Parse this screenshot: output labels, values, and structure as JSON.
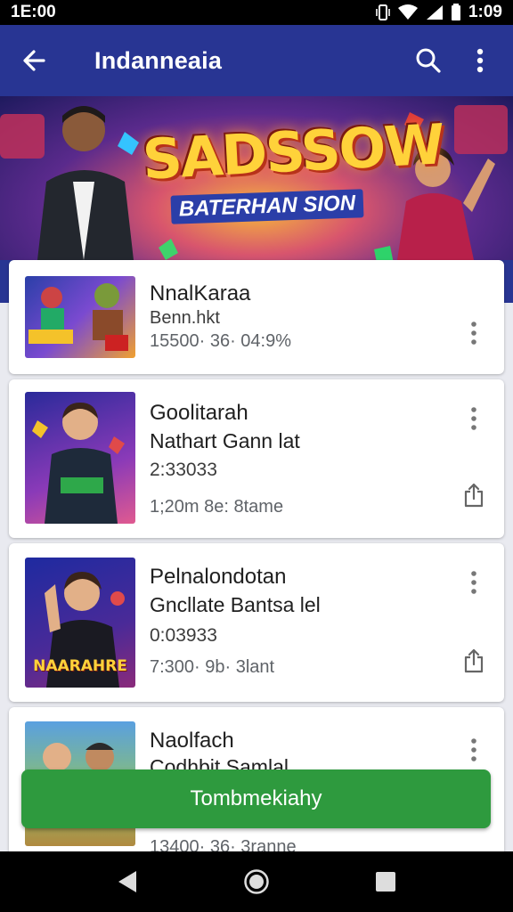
{
  "status": {
    "time_left": "1E:00",
    "time_right": "1:09"
  },
  "app": {
    "title": "Indanneaia"
  },
  "banner": {
    "title": "SADSSOW",
    "subtitle": "BATERHAN SION"
  },
  "items": [
    {
      "title": "NnalKaraa",
      "subtitle": "Benn.hkt",
      "meta": "15500· 36· 04:9%",
      "thumb_text": ""
    },
    {
      "title": "Goolitarah",
      "subtitle": "Nathart Gann lat",
      "extra": "2:33033",
      "meta": "1;20m 8e: 8tame",
      "thumb_text": ""
    },
    {
      "title": "Pelnalondotan",
      "subtitle": "Gncllate Bantsa lel",
      "extra": "0:03933",
      "meta": "7:300· 9b· 3lant",
      "thumb_text": "NAARAHRE"
    },
    {
      "title": "Naolfach",
      "subtitle": "Codhbit Samlal",
      "meta": "13400· 36· 3ranne",
      "thumb_text": ""
    }
  ],
  "install_button": {
    "label": "Tombmekiahy"
  },
  "colors": {
    "app_bar": "#283593",
    "install": "#2e9a3e"
  },
  "icons": [
    "arrow-back-icon",
    "search-icon",
    "more-vert-icon",
    "share-icon",
    "nav-back-icon",
    "nav-home-icon",
    "nav-recents-icon"
  ]
}
